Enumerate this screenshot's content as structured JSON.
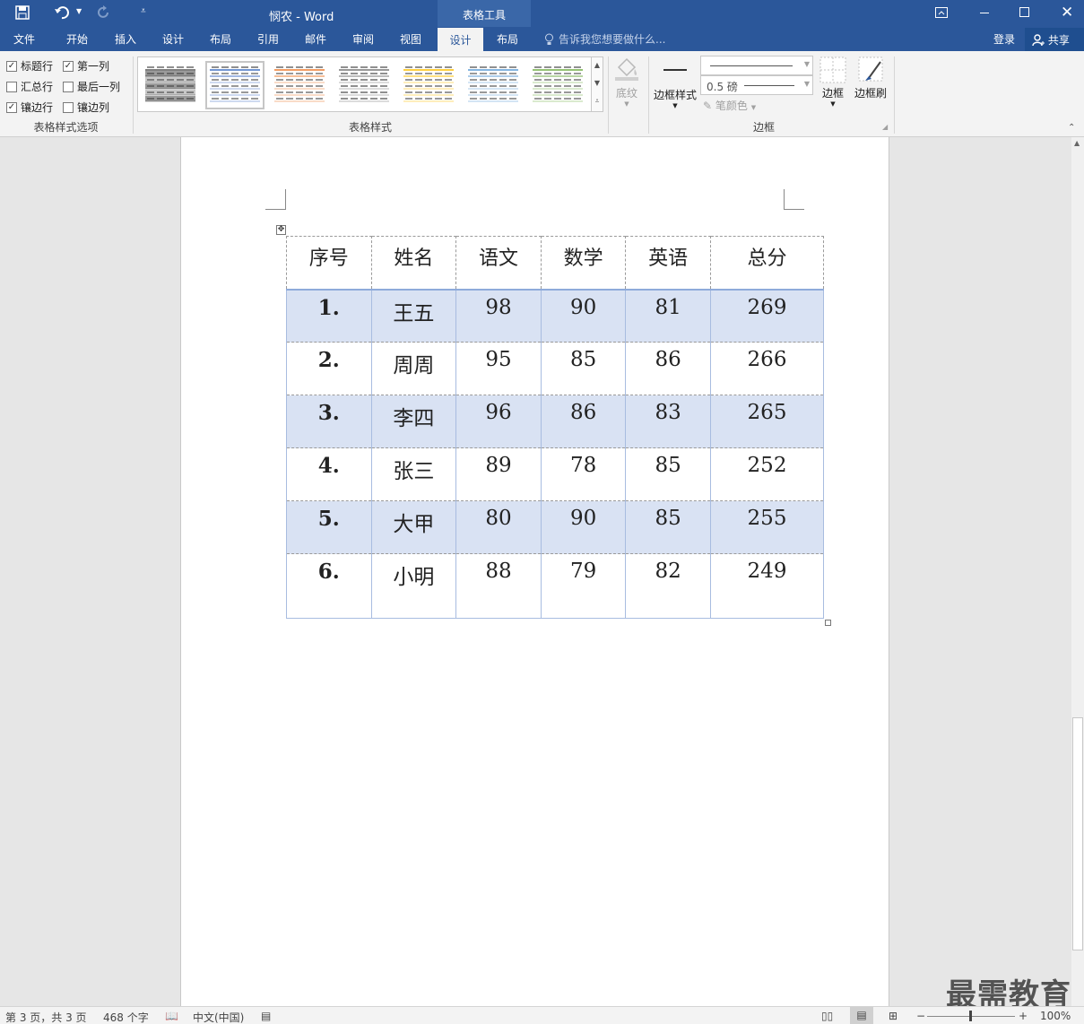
{
  "window": {
    "title": "悯农 - Word",
    "context_group": "表格工具",
    "login": "登录",
    "share": "共享"
  },
  "tabs": [
    "文件",
    "开始",
    "插入",
    "设计",
    "布局",
    "引用",
    "邮件",
    "审阅",
    "视图",
    "设计",
    "布局"
  ],
  "tell_me": "告诉我您想要做什么...",
  "ribbon": {
    "style_options": {
      "group_label": "表格样式选项",
      "items": [
        {
          "label": "标题行",
          "checked": true
        },
        {
          "label": "第一列",
          "checked": true
        },
        {
          "label": "汇总行",
          "checked": false
        },
        {
          "label": "最后一列",
          "checked": false
        },
        {
          "label": "镶边行",
          "checked": true
        },
        {
          "label": "镶边列",
          "checked": false
        }
      ]
    },
    "table_styles": {
      "group_label": "表格样式",
      "accents": [
        "#555555",
        "#4472c4",
        "#ed7d31",
        "#777777",
        "#ffc000",
        "#5b9bd5",
        "#70ad47"
      ]
    },
    "shading": "底纹",
    "borders": {
      "group_label": "边框",
      "border_styles": "边框样式",
      "weight": "0.5 磅",
      "pen_color": "笔颜色",
      "borders": "边框",
      "border_painter": "边框刷"
    }
  },
  "table": {
    "headers": [
      "序号",
      "姓名",
      "语文",
      "数学",
      "英语",
      "总分"
    ],
    "rows": [
      [
        "1.",
        "王五",
        "98",
        "90",
        "81",
        "269"
      ],
      [
        "2.",
        "周周",
        "95",
        "85",
        "86",
        "266"
      ],
      [
        "3.",
        "李四",
        "96",
        "86",
        "83",
        "265"
      ],
      [
        "4.",
        "张三",
        "89",
        "78",
        "85",
        "252"
      ],
      [
        "5.",
        "大甲",
        "80",
        "90",
        "85",
        "255"
      ],
      [
        "6.",
        "小明",
        "88",
        "79",
        "82",
        "249"
      ]
    ]
  },
  "status": {
    "page": "第 3 页，共 3 页",
    "words": "468 个字",
    "language": "中文(中国)",
    "zoom": "100%"
  },
  "watermark": "最需教育"
}
